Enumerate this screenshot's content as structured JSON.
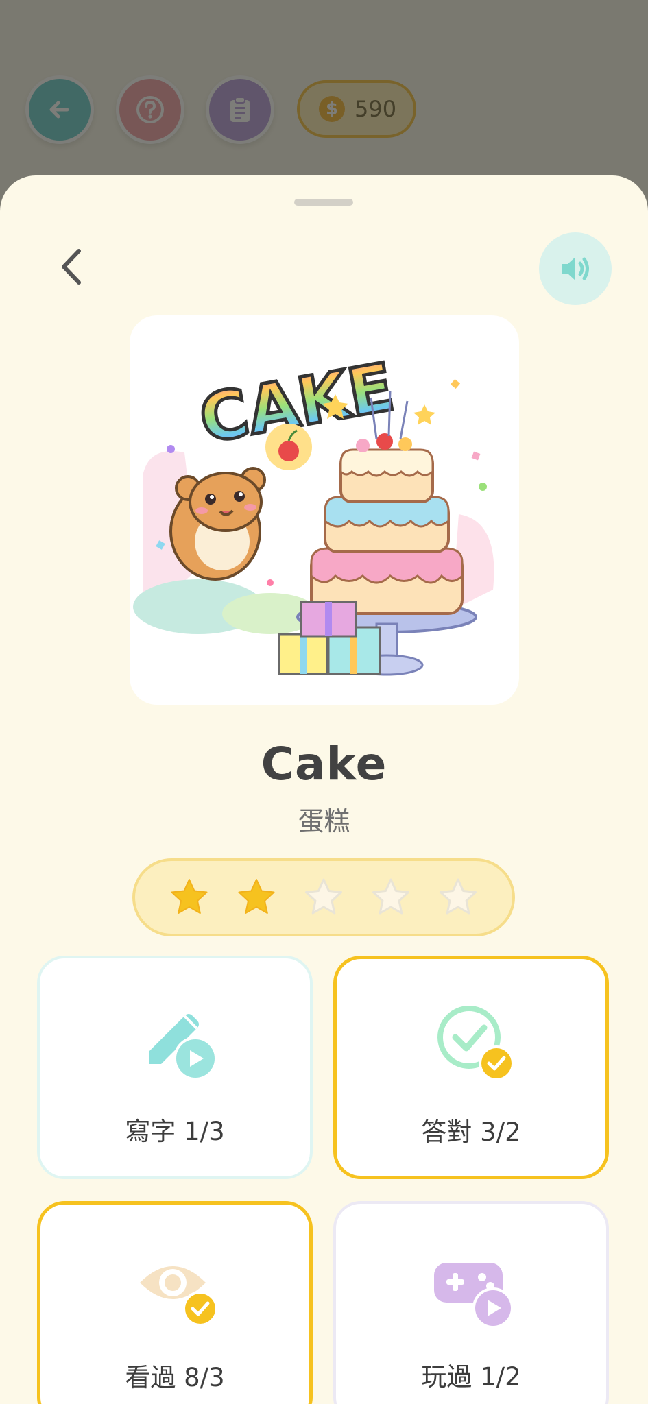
{
  "header": {
    "coins": "590",
    "coin_symbol": "$"
  },
  "word": {
    "english": "Cake",
    "chinese": "蛋糕",
    "illustration_text": "CAKE"
  },
  "rating": {
    "filled": 2,
    "total": 5,
    "filled_color": "#f6c21f",
    "empty_color": "#ece9e0"
  },
  "stats": {
    "write": {
      "label": "寫字 1/3",
      "icon": "pencil-play-icon",
      "color": "#8fe0dc"
    },
    "correct": {
      "label": "答對 3/2",
      "icon": "check-circle-icon",
      "color": "#a8ecc8",
      "completed": true
    },
    "viewed": {
      "label": "看過 8/3",
      "icon": "eye-icon",
      "color": "#f6e2c3",
      "completed": true
    },
    "played": {
      "label": "玩過 1/2",
      "icon": "gamepad-play-icon",
      "color": "#d6b8ea"
    }
  },
  "colors": {
    "accent": "#f6c21f",
    "sheet_background": "#fdf9e8",
    "text_primary": "#424242"
  }
}
